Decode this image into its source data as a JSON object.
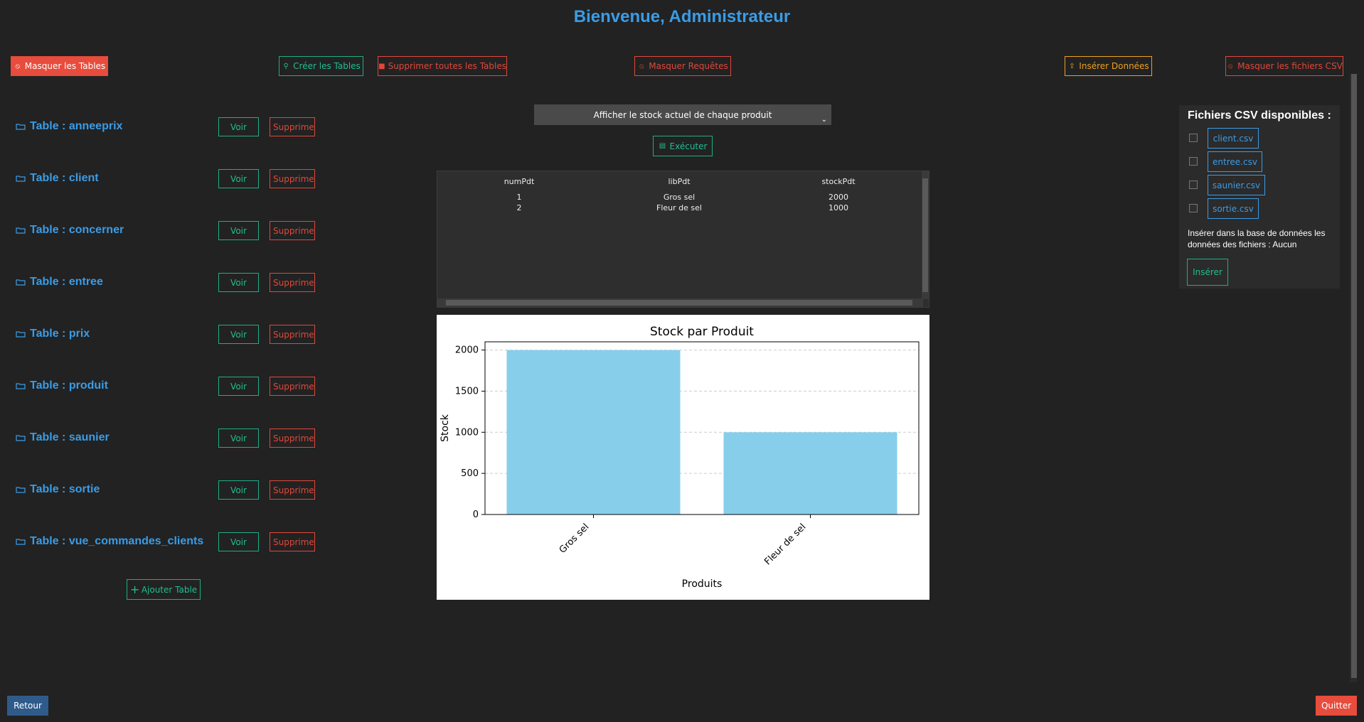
{
  "header": {
    "title": "Bienvenue, Administrateur"
  },
  "toolbar": {
    "hide_tables": "Masquer les Tables",
    "create_tables": "Créer les Tables",
    "delete_all_tables": "Supprimer toutes les Tables",
    "hide_queries": "Masquer Requêtes",
    "insert_data": "Insérer Données",
    "hide_csv": "Masquer les fichiers CSV"
  },
  "tables": [
    {
      "label": "Table : anneeprix",
      "view": "Voir",
      "delete": "Supprimer"
    },
    {
      "label": "Table : client",
      "view": "Voir",
      "delete": "Supprimer"
    },
    {
      "label": "Table : concerner",
      "view": "Voir",
      "delete": "Supprimer"
    },
    {
      "label": "Table : entree",
      "view": "Voir",
      "delete": "Supprimer"
    },
    {
      "label": "Table : prix",
      "view": "Voir",
      "delete": "Supprimer"
    },
    {
      "label": "Table : produit",
      "view": "Voir",
      "delete": "Supprimer"
    },
    {
      "label": "Table : saunier",
      "view": "Voir",
      "delete": "Supprimer"
    },
    {
      "label": "Table : sortie",
      "view": "Voir",
      "delete": "Supprimer"
    },
    {
      "label": "Table : vue_commandes_clients",
      "view": "Voir",
      "delete": "Supprimer"
    }
  ],
  "add_table": "Ajouter Table",
  "query": {
    "selected": "Afficher le stock actuel de chaque produit",
    "execute": "Exécuter"
  },
  "result_table": {
    "columns": [
      "numPdt",
      "libPdt",
      "stockPdt"
    ],
    "rows": [
      [
        "1",
        "Gros sel",
        "2000"
      ],
      [
        "2",
        "Fleur de sel",
        "1000"
      ]
    ]
  },
  "chart_data": {
    "type": "bar",
    "title": "Stock par Produit",
    "xlabel": "Produits",
    "ylabel": "Stock",
    "categories": [
      "Gros sel",
      "Fleur de sel"
    ],
    "values": [
      2000,
      1000
    ],
    "ylim": [
      0,
      2100
    ],
    "yticks": [
      0,
      500,
      1000,
      1500,
      2000
    ],
    "grid": "y-dashed",
    "bar_color": "#87ceeb"
  },
  "csv": {
    "title": "Fichiers CSV disponibles :",
    "files": [
      "client.csv",
      "entree.csv",
      "saunier.csv",
      "sortie.csv"
    ],
    "insert_text": "Insérer dans la base de données les données des fichiers : Aucun",
    "insert_button": "Insérer"
  },
  "footer": {
    "back": "Retour",
    "quit": "Quitter"
  },
  "colors": {
    "accent": "#3a9ce6",
    "green": "#1fbf8f",
    "red": "#e0483a",
    "orange": "#f0a020"
  }
}
